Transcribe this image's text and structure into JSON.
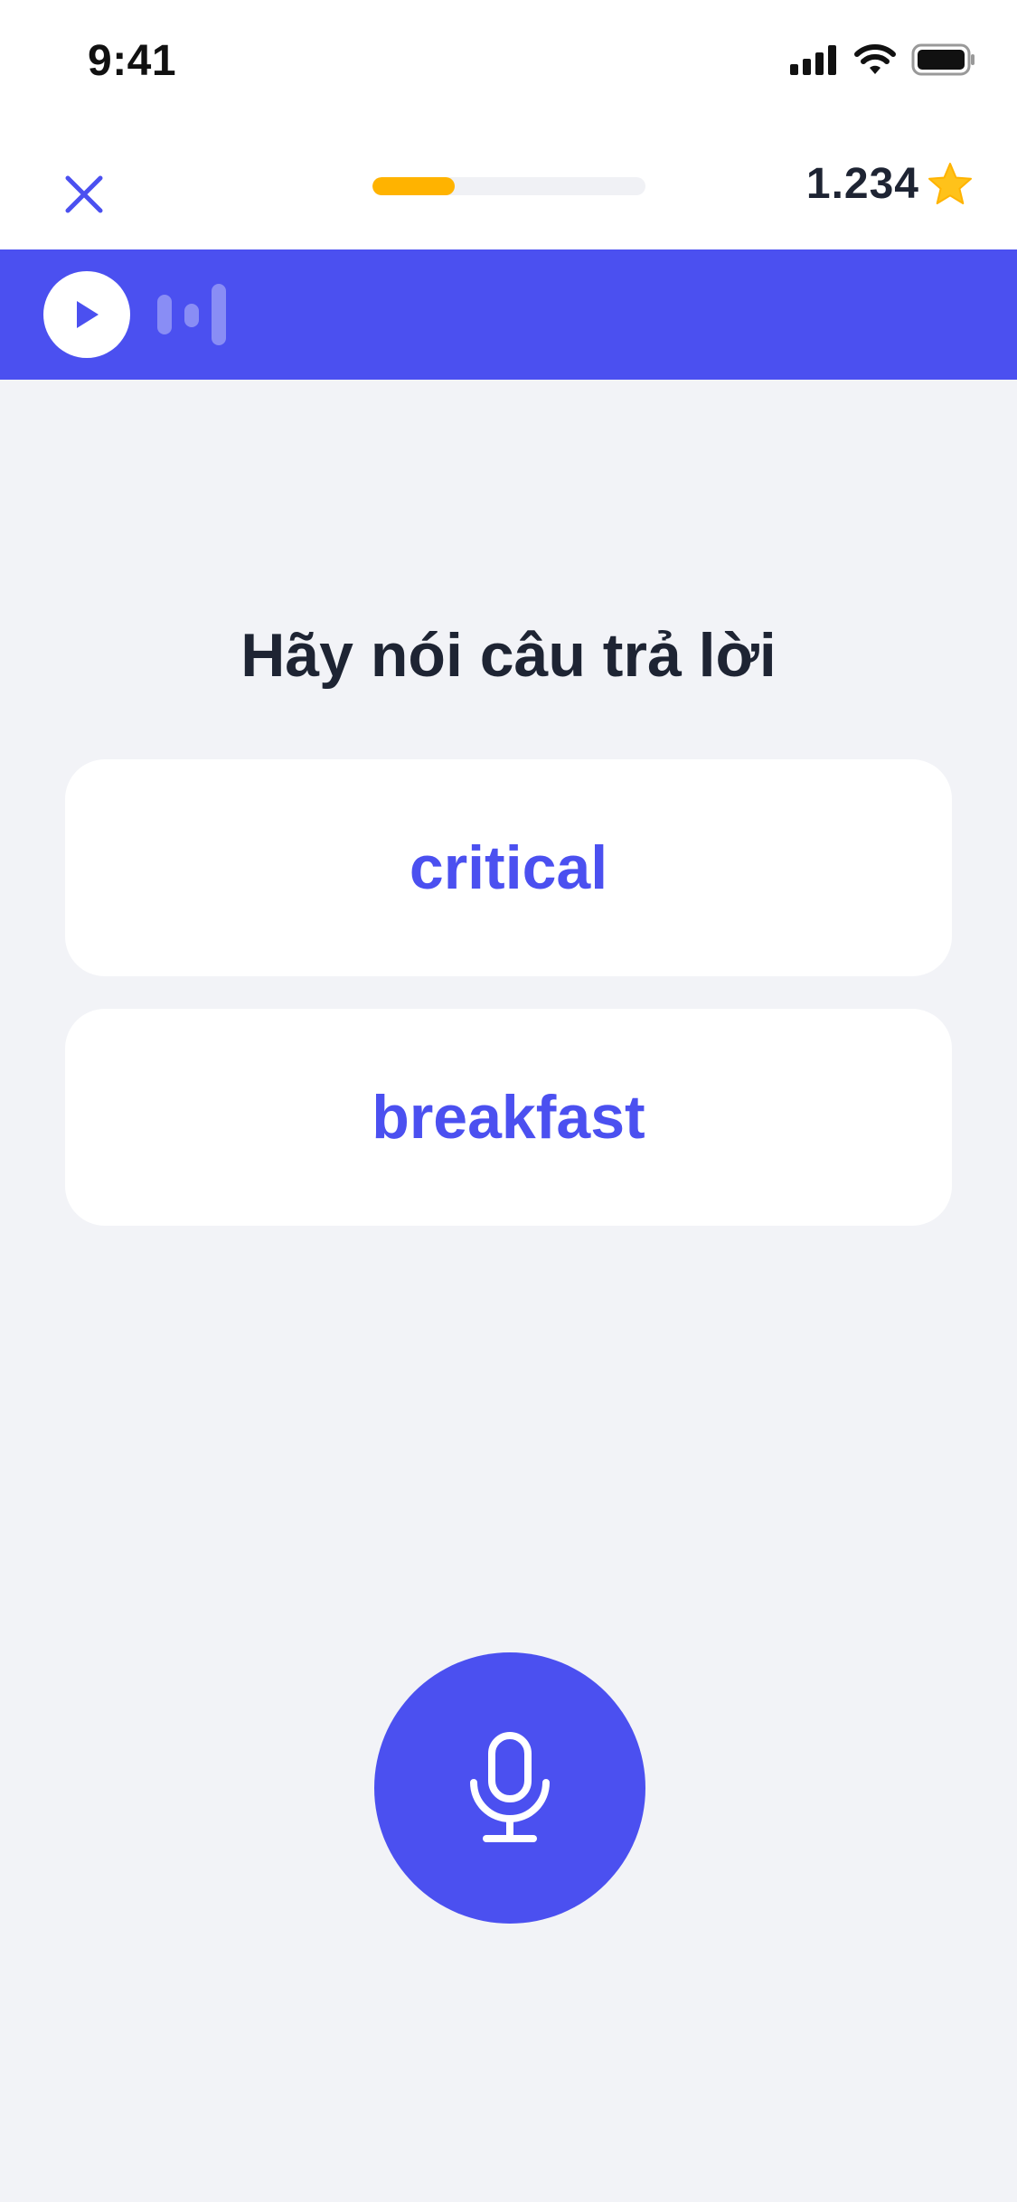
{
  "status_bar": {
    "time": "9:41",
    "icons": [
      "signal-icon",
      "wifi-icon",
      "battery-icon"
    ]
  },
  "header": {
    "close_icon": "close-icon",
    "progress": 0.3,
    "score": "1.234",
    "score_icon": "star-icon"
  },
  "audio": {
    "play_icon": "play-icon",
    "wave_icon": "sound-wave-icon"
  },
  "prompt": "Hãy nói câu trả lời",
  "options": [
    {
      "label": "critical"
    },
    {
      "label": "breakfast"
    }
  ],
  "mic": {
    "icon": "microphone-icon"
  },
  "colors": {
    "primary": "#4B50F0",
    "accent": "#FFB300",
    "background": "#F2F3F7",
    "text": "#1E2433"
  }
}
